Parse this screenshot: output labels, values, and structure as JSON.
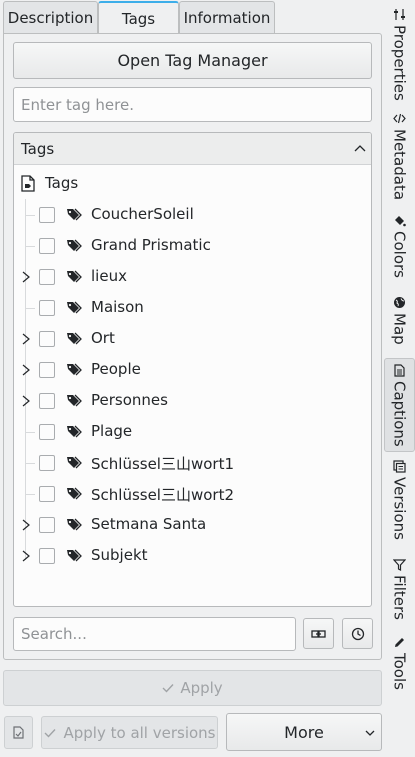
{
  "tabs": [
    {
      "label": "Description"
    },
    {
      "label": "Tags"
    },
    {
      "label": "Information"
    }
  ],
  "open_tag_manager_label": "Open Tag Manager",
  "tag_input_placeholder": "Enter tag here.",
  "tree": {
    "header": "Tags",
    "root": "Tags",
    "items": [
      {
        "label": "CoucherSoleil",
        "expandable": false
      },
      {
        "label": "Grand Prismatic",
        "expandable": false
      },
      {
        "label": "lieux",
        "expandable": true
      },
      {
        "label": "Maison",
        "expandable": false
      },
      {
        "label": "Ort",
        "expandable": true
      },
      {
        "label": "People",
        "expandable": true
      },
      {
        "label": "Personnes",
        "expandable": true
      },
      {
        "label": "Plage",
        "expandable": false
      },
      {
        "label": "Schlüssel三山wort1",
        "expandable": false
      },
      {
        "label": "Schlüssel三山wort2",
        "expandable": false
      },
      {
        "label": "Setmana Santa",
        "expandable": true
      },
      {
        "label": "Subjekt",
        "expandable": true
      }
    ]
  },
  "search_placeholder": "Search...",
  "apply_label": "Apply",
  "apply_all_label": "Apply to all versions",
  "more_label": "More",
  "sidebar": [
    {
      "label": "Properties",
      "icon": "sliders-icon"
    },
    {
      "label": "Metadata",
      "icon": "code-icon"
    },
    {
      "label": "Colors",
      "icon": "paint-bucket-icon"
    },
    {
      "label": "Map",
      "icon": "globe-icon"
    },
    {
      "label": "Captions",
      "icon": "document-icon",
      "active": true
    },
    {
      "label": "Versions",
      "icon": "versions-icon"
    },
    {
      "label": "Filters",
      "icon": "filter-icon"
    },
    {
      "label": "Tools",
      "icon": "pencil-icon"
    }
  ],
  "colors": {
    "accent": "#3daee9",
    "background": "#eff0f1"
  }
}
